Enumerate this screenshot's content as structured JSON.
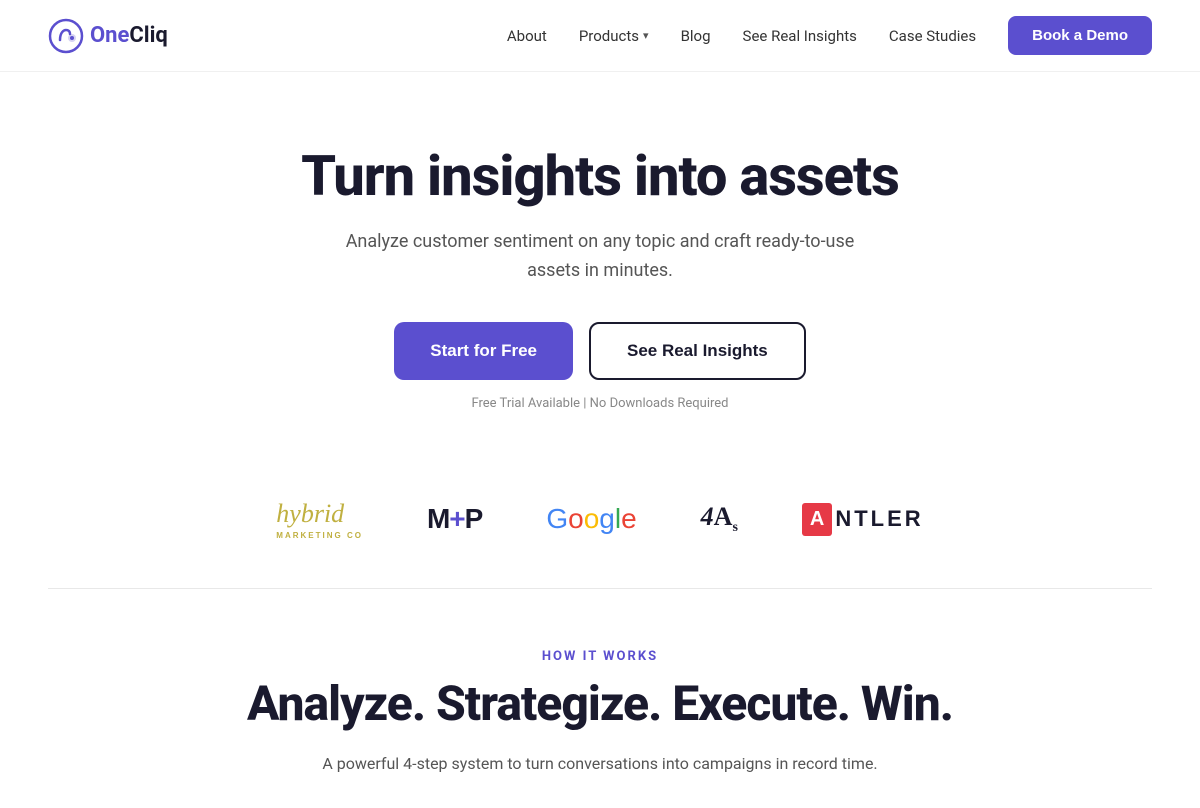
{
  "nav": {
    "logo_text": "OneCliq",
    "links": [
      {
        "id": "about",
        "label": "About"
      },
      {
        "id": "products",
        "label": "Products"
      },
      {
        "id": "blog",
        "label": "Blog"
      },
      {
        "id": "see-real-insights",
        "label": "See Real Insights"
      },
      {
        "id": "case-studies",
        "label": "Case Studies"
      }
    ],
    "book_demo_label": "Book a Demo"
  },
  "hero": {
    "title": "Turn insights into assets",
    "subtitle": "Analyze customer sentiment on any topic and craft ready-to-use assets in minutes.",
    "cta_primary": "Start for Free",
    "cta_secondary": "See Real Insights",
    "note": "Free Trial Available | No Downloads Required"
  },
  "logos": [
    {
      "id": "hybrid",
      "name": "Hybrid Marketing Co"
    },
    {
      "id": "mp",
      "name": "M+P"
    },
    {
      "id": "google",
      "name": "Google"
    },
    {
      "id": "fours",
      "name": "4A's"
    },
    {
      "id": "antler",
      "name": "ANTLER"
    }
  ],
  "how_it_works": {
    "label": "HOW IT WORKS",
    "title": "Analyze. Strategize. Execute. Win.",
    "subtitle": "A powerful 4-step system to turn conversations into campaigns in record time."
  }
}
